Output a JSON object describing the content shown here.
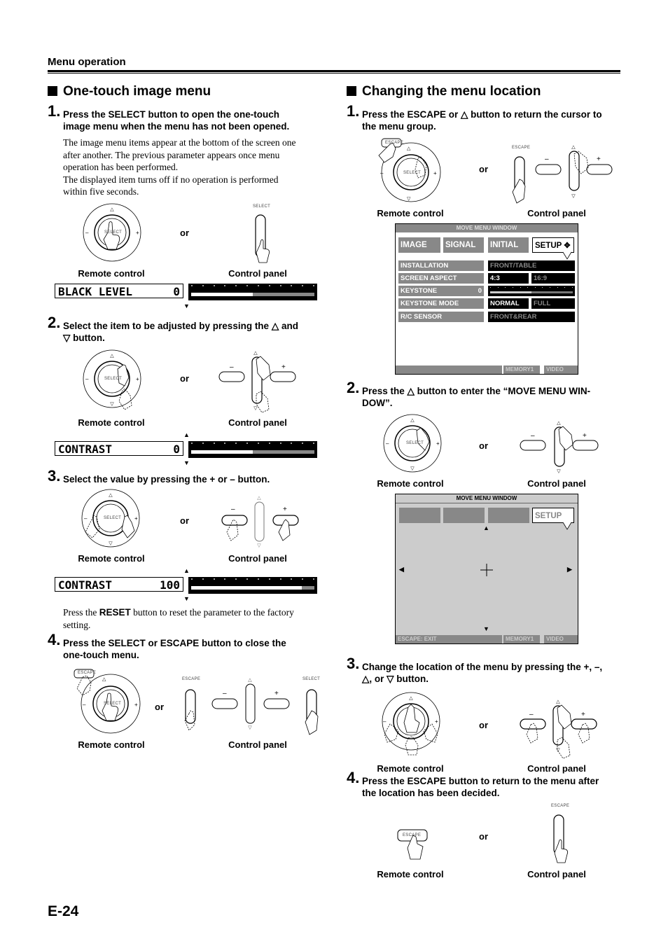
{
  "header": {
    "section": "Menu operation"
  },
  "left": {
    "title": "One-touch image menu",
    "steps": [
      {
        "num": "1.",
        "text_line1": "Press the SELECT button to open the one-touch",
        "text_line2": "image menu when the menu has not been opened.",
        "body": [
          "The image menu items appear at the bottom of the screen one",
          "after another. The previous parameter appears once menu",
          "operation has been performed.",
          "The displayed item turns off if no operation is performed",
          "within five seconds."
        ],
        "remote_label": "Remote control",
        "or": "or",
        "panel_label": "Control panel",
        "panel_button_label": "SELECT",
        "remote_button_label": "SELECT",
        "osd": {
          "item": "BLACK LEVEL",
          "value": "0",
          "level": 0.5
        }
      },
      {
        "num": "2.",
        "text_line1": "Select the item to be adjusted by pressing the △ and",
        "text_line2": "▽ button.",
        "remote_label": "Remote control",
        "or": "or",
        "panel_label": "Control panel",
        "remote_button_label": "SELECT",
        "osd": {
          "item": "CONTRAST",
          "value": "0",
          "level": 0.5
        }
      },
      {
        "num": "3.",
        "text_line1": "Select the value by pressing the + or – button.",
        "remote_label": "Remote control",
        "or": "or",
        "panel_label": "Control panel",
        "remote_button_label": "SELECT",
        "osd": {
          "item": "CONTRAST",
          "value": "100",
          "level": 0.9
        },
        "note_pre": "Press the ",
        "note_bold": "RESET",
        "note_post": " button to reset the parameter to the factory",
        "note_line2": "setting."
      },
      {
        "num": "4.",
        "text_line1": "Press the SELECT or ESCAPE button to close the",
        "text_line2": "one-touch menu.",
        "remote_label": "Remote control",
        "or": "or",
        "panel_label": "Control panel",
        "remote_escape_label": "ESCAPE",
        "remote_button_label": "SELECT",
        "panel_escape_label": "ESCAPE",
        "panel_select_label": "SELECT"
      }
    ]
  },
  "right": {
    "title": "Changing the menu location",
    "steps": [
      {
        "num": "1.",
        "text_line1": "Press the ESCAPE or △ button to return the cursor to",
        "text_line2": "the menu group.",
        "remote_label": "Remote control",
        "or": "or",
        "panel_label": "Control panel",
        "remote_escape_label": "ESCAPE",
        "remote_button_label": "SELECT",
        "panel_escape_label": "ESCAPE"
      },
      {
        "num": "2.",
        "text_line1": "Press the △ button to enter the “MOVE MENU WIN-",
        "text_line2": "DOW”.",
        "remote_label": "Remote control",
        "or": "or",
        "panel_label": "Control panel",
        "remote_button_label": "SELECT"
      },
      {
        "num": "3.",
        "text_line1": "Change the location of the menu by pressing the +, –,",
        "text_line2": "△, or ▽ button.",
        "remote_label": "Remote control",
        "or": "or",
        "panel_label": "Control panel"
      },
      {
        "num": "4.",
        "text_line1": "Press the ESCAPE button to return to the menu after",
        "text_line2": "the location has been decided.",
        "remote_label": "Remote control",
        "or": "or",
        "panel_label": "Control panel",
        "remote_escape_label": "ESCAPE",
        "panel_escape_label": "ESCAPE"
      }
    ],
    "osd1": {
      "title": "MOVE MENU WINDOW",
      "tabs": [
        "IMAGE",
        "SIGNAL",
        "INITIAL",
        "SETUP"
      ],
      "rows": [
        {
          "label": "INSTALLATION",
          "value": "FRONT/TABLE"
        },
        {
          "label": "SCREEN ASPECT",
          "opt1": "4:3",
          "opt2": "16:9"
        },
        {
          "label": "KEYSTONE",
          "num": "0",
          "level": 0.5
        },
        {
          "label": "KEYSTONE MODE",
          "opt1": "NORMAL",
          "opt2": "FULL"
        },
        {
          "label": "R/C SENSOR",
          "value": "FRONT&REAR"
        }
      ],
      "footer": {
        "memory": "MEMORY1",
        "input": "VIDEO"
      }
    },
    "osd2": {
      "title": "MOVE MENU WINDOW",
      "tab_selected": "SETUP",
      "footer": {
        "exit": "ESCAPE: EXIT",
        "memory": "MEMORY1",
        "input": "VIDEO"
      }
    }
  },
  "footer": {
    "page_number": "E-24"
  }
}
